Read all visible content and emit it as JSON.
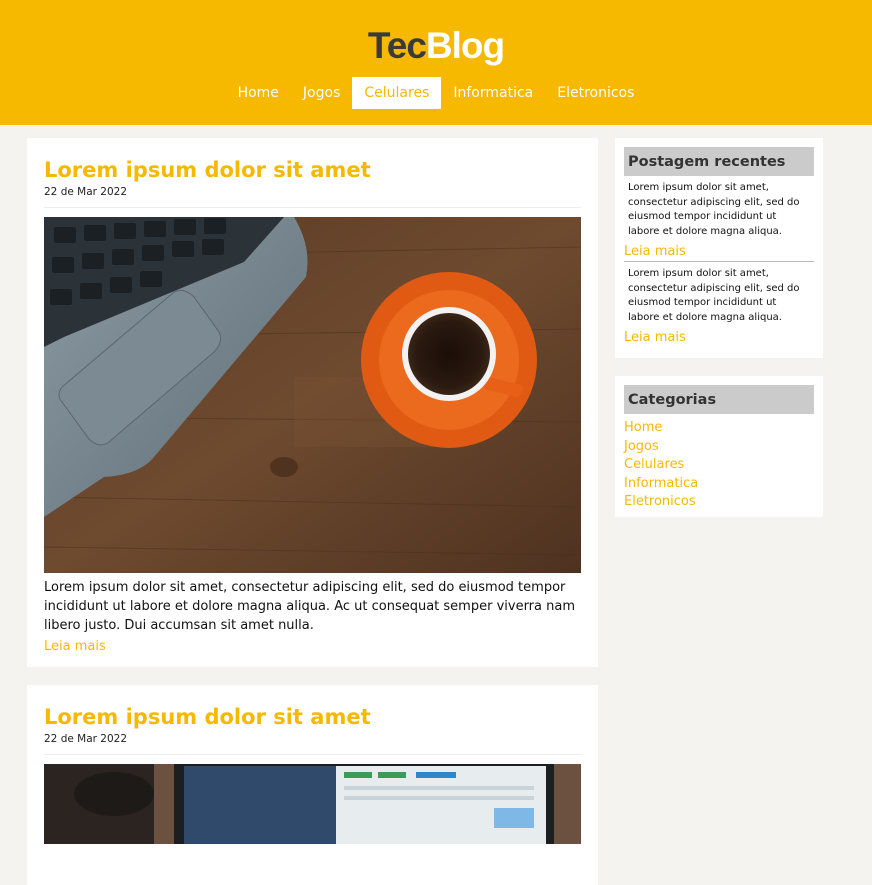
{
  "header": {
    "logo_part1": "Tec",
    "logo_part2": "Blog",
    "nav": [
      "Home",
      "Jogos",
      "Celulares",
      "Informatica",
      "Eletronicos"
    ],
    "active_nav": "Celulares",
    "accent_color": "#f7b800"
  },
  "posts": [
    {
      "title": "Lorem ipsum dolor sit amet",
      "date": "22 de Mar 2022",
      "image": "laptop-and-orange-coffee-cup-on-wooden-desk",
      "text": "Lorem ipsum dolor sit amet, consectetur adipiscing elit, sed do eiusmod tempor incididunt ut labore et dolore magna aliqua. Ac ut consequat semper viverra nam libero justo. Dui accumsan sit amet nulla.",
      "read_more": "Leia mais"
    },
    {
      "title": "Lorem ipsum dolor sit amet",
      "date": "22 de Mar 2022",
      "image": "laptop-screen-with-dashboard"
    }
  ],
  "sidebar": {
    "recent": {
      "title": "Postagem recentes",
      "items": [
        {
          "text": "Lorem ipsum dolor sit amet, consectetur adipiscing elit, sed do eiusmod tempor incididunt ut labore et dolore magna aliqua.",
          "link": "Leia mais"
        },
        {
          "text": "Lorem ipsum dolor sit amet, consectetur adipiscing elit, sed do eiusmod tempor incididunt ut labore et dolore magna aliqua.",
          "link": "Leia mais"
        }
      ]
    },
    "categories": {
      "title": "Categorias",
      "items": [
        "Home",
        "Jogos",
        "Celulares",
        "Informatica",
        "Eletronicos"
      ]
    }
  }
}
